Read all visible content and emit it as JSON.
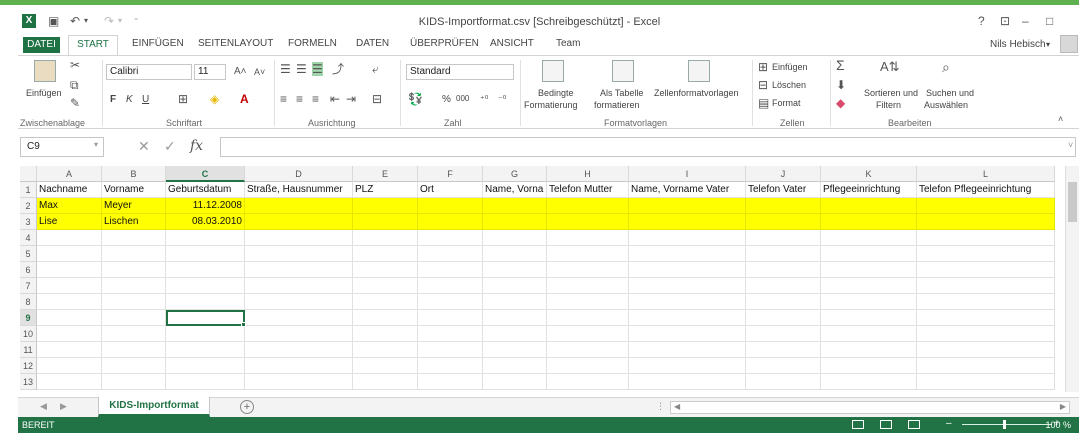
{
  "window": {
    "title": "KIDS-Importformat.csv  [Schreibgeschützt] - Excel",
    "help": "?",
    "controls": [
      "⊡",
      "–",
      "□"
    ]
  },
  "ribbon_tabs": {
    "file": "DATEI",
    "active": "START",
    "others": [
      "EINFÜGEN",
      "SEITENLAYOUT",
      "FORMELN",
      "DATEN",
      "ÜBERPRÜFEN",
      "ANSICHT",
      "Team"
    ]
  },
  "user": {
    "name": "Nils Hebisch"
  },
  "ribbon": {
    "clipboard": {
      "paste": "Einfügen",
      "label": "Zwischenablage"
    },
    "font": {
      "name": "Calibri",
      "size": "11",
      "bold": "F",
      "italic": "K",
      "underline": "U",
      "label": "Schriftart"
    },
    "alignment": {
      "label": "Ausrichtung"
    },
    "number": {
      "format": "Standard",
      "percent": "%",
      "thousands": "000",
      "label": "Zahl"
    },
    "styles": {
      "conditional_1": "Bedingte",
      "conditional_2": "Formatierung",
      "table_1": "Als Tabelle",
      "table_2": "formatieren",
      "cellstyles_1": "Zellenformatvorlagen",
      "label": "Formatvorlagen"
    },
    "cells": {
      "insert": "Einfügen",
      "delete": "Löschen",
      "format": "Format",
      "label": "Zellen"
    },
    "editing": {
      "sort_1": "Sortieren und",
      "sort_2": "Filtern",
      "find_1": "Suchen und",
      "find_2": "Auswählen",
      "label": "Bearbeiten"
    }
  },
  "formula_bar": {
    "name_box": "C9",
    "fx": "fx",
    "value": ""
  },
  "grid": {
    "columns": [
      "A",
      "B",
      "C",
      "D",
      "E",
      "F",
      "G",
      "H",
      "I",
      "J",
      "K",
      "L"
    ],
    "row_numbers": [
      "1",
      "2",
      "3",
      "4",
      "5",
      "6",
      "7",
      "8",
      "9",
      "10",
      "11",
      "12",
      "13"
    ],
    "header_row": [
      "Nachname",
      "Vorname",
      "Geburtsdatum",
      "Straße, Hausnummer",
      "PLZ",
      "Ort",
      "Name, Vorna",
      "Telefon Mutter",
      "Name, Vorname Vater",
      "Telefon Vater",
      "Pflegeeinrichtung",
      "Telefon Pflegeeinrichtung"
    ],
    "data_rows": [
      [
        "Max",
        "Meyer",
        "11.12.2008"
      ],
      [
        "Lise",
        "Lischen",
        "08.03.2010"
      ]
    ],
    "highlight_color": "#ffff00"
  },
  "sheets": {
    "active": "KIDS-Importformat",
    "add": "+"
  },
  "status": {
    "text": "BEREIT",
    "zoom": "100 %"
  },
  "colors": {
    "excel_green": "#217346",
    "accent": "#5fb04f"
  }
}
